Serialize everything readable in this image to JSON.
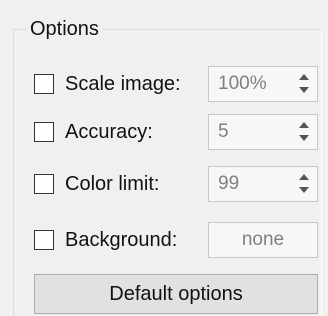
{
  "options": {
    "group_title": "Options",
    "scale_image": {
      "label": "Scale image:",
      "checked": false,
      "value": "100%"
    },
    "accuracy": {
      "label": "Accuracy:",
      "checked": false,
      "value": "5"
    },
    "color_limit": {
      "label": "Color limit:",
      "checked": false,
      "value": "99"
    },
    "background": {
      "label": "Background:",
      "checked": false,
      "value": "none"
    },
    "default_button_label": "Default options"
  }
}
